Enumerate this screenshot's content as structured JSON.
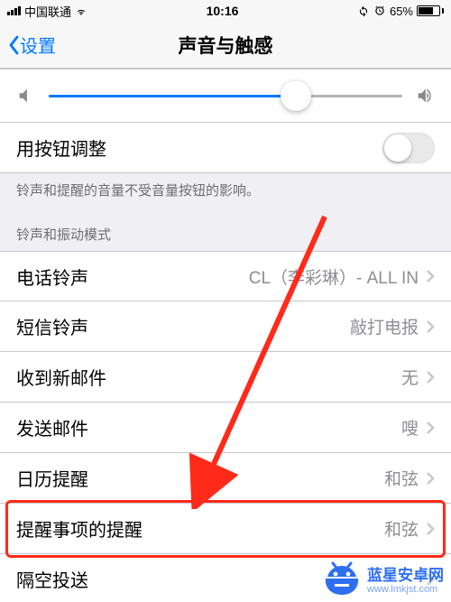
{
  "status": {
    "carrier": "中国联通",
    "time": "10:16",
    "battery_pct": "65%"
  },
  "nav": {
    "back_label": "设置",
    "title": "声音与触感"
  },
  "slider": {
    "value_pct": 70
  },
  "button_adjust": {
    "label": "用按钮调整",
    "on": false,
    "footer": "铃声和提醒的音量不受音量按钮的影响。"
  },
  "ringtone_section_header": "铃声和振动模式",
  "rows": {
    "ringtone": {
      "label": "电话铃声",
      "value": "CL（李彩琳）- ALL IN"
    },
    "text_tone": {
      "label": "短信铃声",
      "value": "敲打电报"
    },
    "new_mail": {
      "label": "收到新邮件",
      "value": "无"
    },
    "sent_mail": {
      "label": "发送邮件",
      "value": "嗖"
    },
    "calendar": {
      "label": "日历提醒",
      "value": "和弦"
    },
    "reminders": {
      "label": "提醒事项的提醒",
      "value": "和弦"
    },
    "airdrop": {
      "label": "隔空投送",
      "value": ""
    }
  },
  "annotation": {
    "highlight_target": "reminders"
  },
  "watermark": {
    "name": "蓝星安卓网",
    "url": "www.lmkjst.com"
  }
}
